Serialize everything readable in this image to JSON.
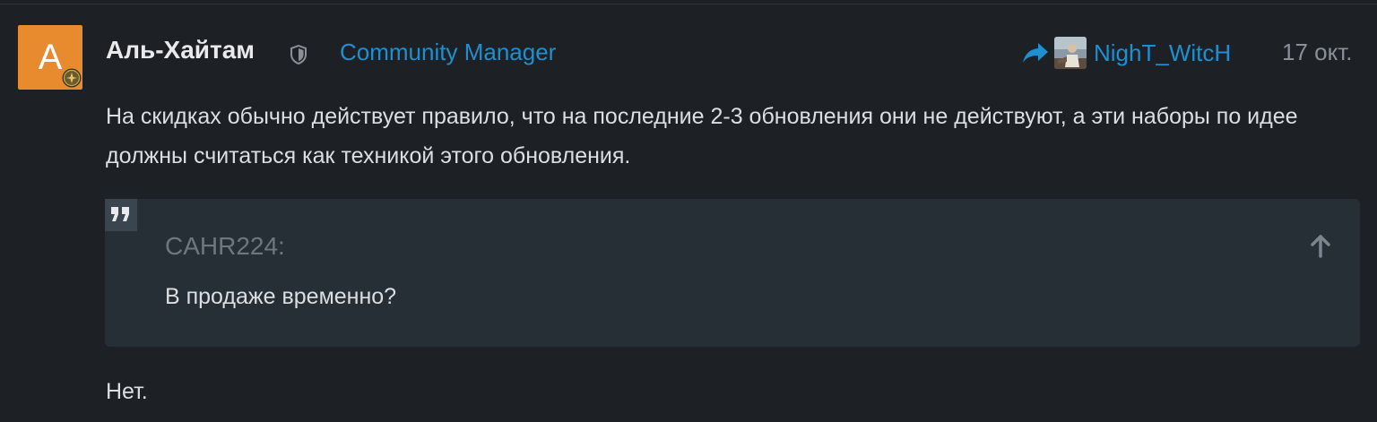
{
  "post": {
    "avatar_letter": "A",
    "author": "Аль-Хайтам",
    "author_title": "Community Manager",
    "reply_to": "NighT_WitcH",
    "date": "17 окт.",
    "body_paragraph": "На скидках обычно действует правило, что на последние 2-3 обновления они не действуют, а эти наборы по идее должны считаться как техникой этого обновления.",
    "quote": {
      "author": "CAHR224:",
      "text": "В продаже временно?"
    },
    "tail": "Нет."
  },
  "colors": {
    "background": "#1d2125",
    "avatar_bg": "#e88a2e",
    "accent_link": "#1e8fd0",
    "quote_bg": "#272f36",
    "muted": "#8a9097"
  },
  "icons": {
    "avatar_badge": "medal-icon",
    "moderator": "shield-icon",
    "reply": "reply-arrow-icon",
    "quote": "quote-icon",
    "expand": "arrow-up-icon"
  }
}
